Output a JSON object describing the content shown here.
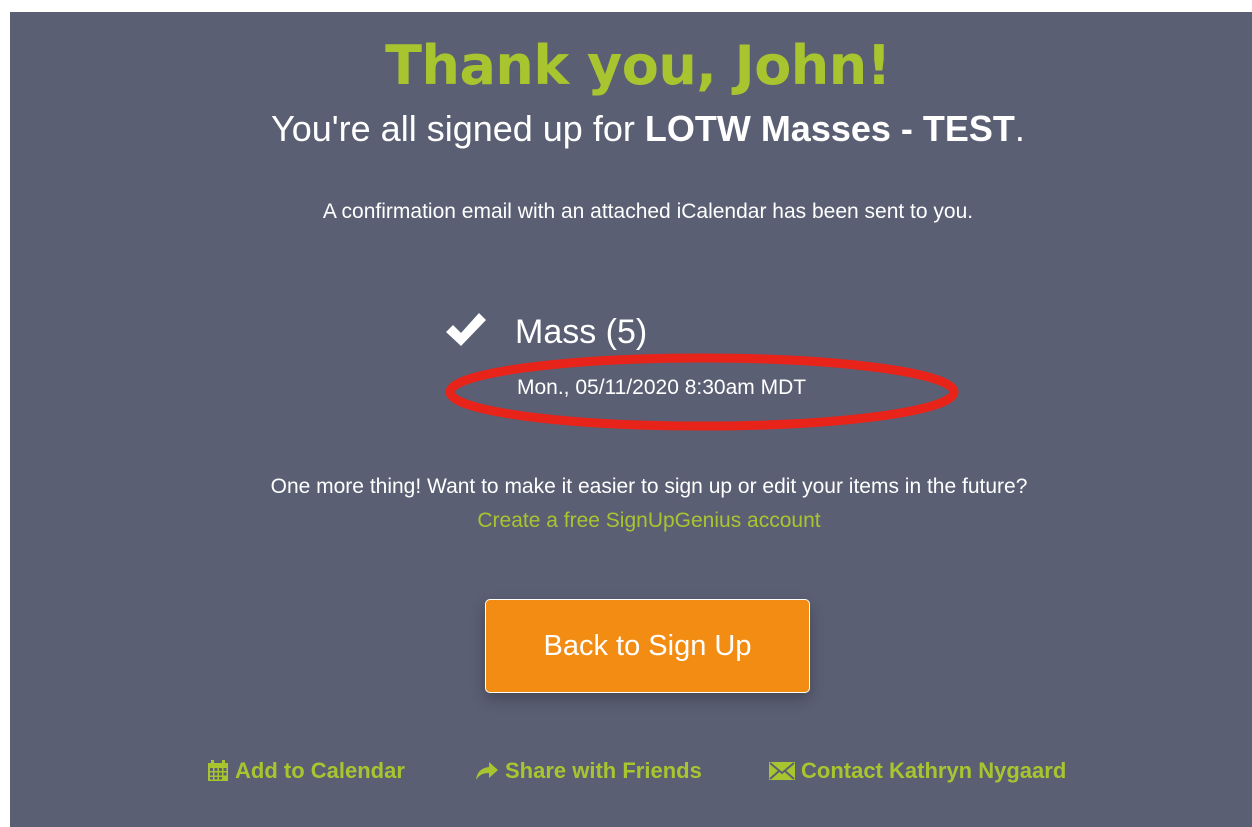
{
  "confirmation": {
    "title": "Thank you, John!",
    "subtitle_prefix": "You're all signed up for ",
    "signup_name": "LOTW Masses - TEST",
    "subtitle_suffix": ".",
    "email_notice": "A confirmation email with an attached iCalendar has been sent to you."
  },
  "slot": {
    "icon": "checkmark-icon",
    "name": "Mass (5)",
    "datetime": "Mon., 05/11/2020 8:30am MDT",
    "annotation_color": "#e8231a"
  },
  "account_prompt": {
    "text": "One more thing! Want to make it easier to sign up or edit your items in the future?",
    "link_label": "Create a free SignUpGenius account"
  },
  "back_button": {
    "label": "Back to Sign Up",
    "color": "#f28c13"
  },
  "footer": {
    "links": [
      {
        "icon": "calendar-icon",
        "label": "Add to Calendar"
      },
      {
        "icon": "share-arrow-icon",
        "label": "Share with Friends"
      },
      {
        "icon": "envelope-icon",
        "label": "Contact Kathryn Nygaard"
      }
    ]
  },
  "colors": {
    "background": "#5a5f73",
    "accent": "#a8c530",
    "text": "#ffffff"
  }
}
